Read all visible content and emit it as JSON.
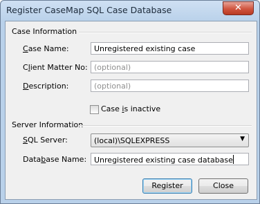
{
  "window": {
    "title": "Register CaseMap SQL Case Database",
    "close_glyph": "✕"
  },
  "case_info": {
    "group_title": "Case Information",
    "case_name_label_u": "C",
    "case_name_label_rest": "ase Name:",
    "case_name_value": "Unregistered existing case",
    "client_matter_label_pre": "C",
    "client_matter_label_u": "l",
    "client_matter_label_rest": "ient Matter No:",
    "client_matter_placeholder": "(optional)",
    "description_label_u": "D",
    "description_label_rest": "escription:",
    "description_placeholder": "(optional)",
    "inactive_label_pre": "Case ",
    "inactive_label_u": "i",
    "inactive_label_rest": "s inactive",
    "inactive_checked": false
  },
  "server_info": {
    "group_title": "Server Information",
    "sql_server_label_u": "S",
    "sql_server_label_rest": "QL Server:",
    "sql_server_value": "(local)\\SQLEXPRESS",
    "db_name_label_pre": "Data",
    "db_name_label_u": "b",
    "db_name_label_rest": "ase Name:",
    "db_name_value": "Unregistered existing case database"
  },
  "buttons": {
    "register": "Register",
    "close": "Close"
  }
}
